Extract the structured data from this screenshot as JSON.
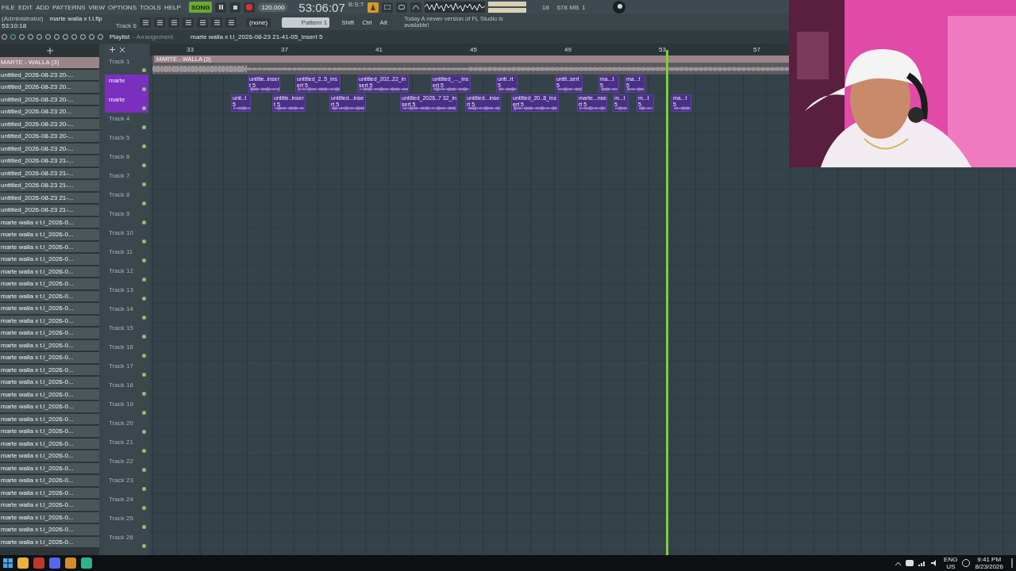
{
  "menu": [
    "FILE",
    "EDIT",
    "ADD",
    "PATTERNS",
    "VIEW",
    "OPTIONS",
    "TOOLS",
    "HELP"
  ],
  "transport": {
    "mode": "SONG",
    "tempo": "120.000",
    "time": "53:06:07",
    "time_unit": "B:S:T",
    "cpu": "18",
    "memory": "678 MB",
    "polyphony": "1"
  },
  "info": {
    "user": "(Administrator)",
    "project": "marte walla x t.l.flp",
    "clock": "53:10:18",
    "hint_target": "Track 6"
  },
  "pattern_bar": {
    "channel": "(none)",
    "pattern": "Pattern 1",
    "keys": [
      "Shift",
      "Ctrl",
      "Alt"
    ],
    "news": "Today  A newer version of FL Studio is available!"
  },
  "playlist": {
    "title": "Playlist",
    "subtitle": "- Arrangement",
    "path": "marte walla x t.l_2026-08-23 21-41-05_Insert 5"
  },
  "browser": {
    "header": "MARTE - WALLA (3)",
    "items": [
      "untitled_2026-08-23 20-...",
      "untitled_2026-08-23 20...",
      "untitled_2026-08-23 20-...",
      "untitled_2026-08-23 20...",
      "untitled_2026-08-23 20-...",
      "untitled_2026-08-23 20-...",
      "untitled_2026-08-23 20-...",
      "untitled_2026-08-23 21-...",
      "untitled_2026-08-23 21-...",
      "untitled_2026-08-23 21-...",
      "untitled_2026-08-23 21-...",
      "untitled_2026-08-23 21-...",
      "marte walla x t.l_2026-0...",
      "marte walla x t.l_2026-0...",
      "marte walla x t.l_2026-0...",
      "marte walla x t.l_2026-0...",
      "marte walla x t.l_2026-0...",
      "marte walla x t.l_2026-0...",
      "marte walla x t.l_2026-0...",
      "marte walla x t.l_2026-0...",
      "marte walla x t.l_2026-0...",
      "marte walla x t.l_2026-0...",
      "marte walla x t.l_2026-0...",
      "marte walla x t.l_2026-0...",
      "marte walla x t.l_2026-0...",
      "marte walla x t.l_2026-0...",
      "marte walla x t.l_2026-0...",
      "marte walla x t.l_2026-0...",
      "marte walla x t.l_2026-0...",
      "marte walla x t.l_2026-0...",
      "marte walla x t.l_2026-0...",
      "marte walla x t.l_2026-0...",
      "marte walla x t.l_2026-0...",
      "marte walla x t.l_2026-0...",
      "marte walla x t.l_2026-0...",
      "marte walla x t.l_2026-0...",
      "marte walla x t.l_2026-0...",
      "marte walla x t.l_2026-0...",
      "marte walla x t.l_2026-0..."
    ]
  },
  "ruler": [
    "33",
    "37",
    "41",
    "45",
    "49",
    "53",
    "57"
  ],
  "tracks": [
    {
      "name": "Track 1"
    },
    {
      "name": "marte",
      "color": "#7b2fbf"
    },
    {
      "name": "marte",
      "color": "#7b2fbf"
    },
    {
      "name": "Track 4"
    },
    {
      "name": "Track 5"
    },
    {
      "name": "Track 6"
    },
    {
      "name": "Track 7"
    },
    {
      "name": "Track 8"
    },
    {
      "name": "Track 9"
    },
    {
      "name": "Track 10"
    },
    {
      "name": "Track 11"
    },
    {
      "name": "Track 12"
    },
    {
      "name": "Track 13"
    },
    {
      "name": "Track 14"
    },
    {
      "name": "Track 15"
    },
    {
      "name": "Track 16"
    },
    {
      "name": "Track 17"
    },
    {
      "name": "Track 18"
    },
    {
      "name": "Track 19"
    },
    {
      "name": "Track 20"
    },
    {
      "name": "Track 21"
    },
    {
      "name": "Track 22"
    },
    {
      "name": "Track 23"
    },
    {
      "name": "Track 24"
    },
    {
      "name": "Track 25"
    },
    {
      "name": "Track 26"
    }
  ],
  "audio_clip": "MARTE - WALLA (3)",
  "clips": [
    "untitle..insert 5",
    "untitled_2..5_insert 5",
    "untitled_202..22_insert 5",
    "untitled_..._insert 5",
    "unti..rt 5",
    "untit..sert 5",
    "ma...t 5",
    "ma...t 5",
    "unti..t 5",
    "untitle..insert 5",
    "untitled...insert 5",
    "untitled_2026..7 32_insert 5",
    "untitled...insert 5",
    "untitled_20..8_insert 5",
    "marte...nsert 5",
    "m...t 5",
    "m...t 5",
    "ma...t 5"
  ],
  "taskbar": {
    "lang": "ENG",
    "region": "US",
    "time": "9:41 PM",
    "date": "8/23/2026"
  }
}
